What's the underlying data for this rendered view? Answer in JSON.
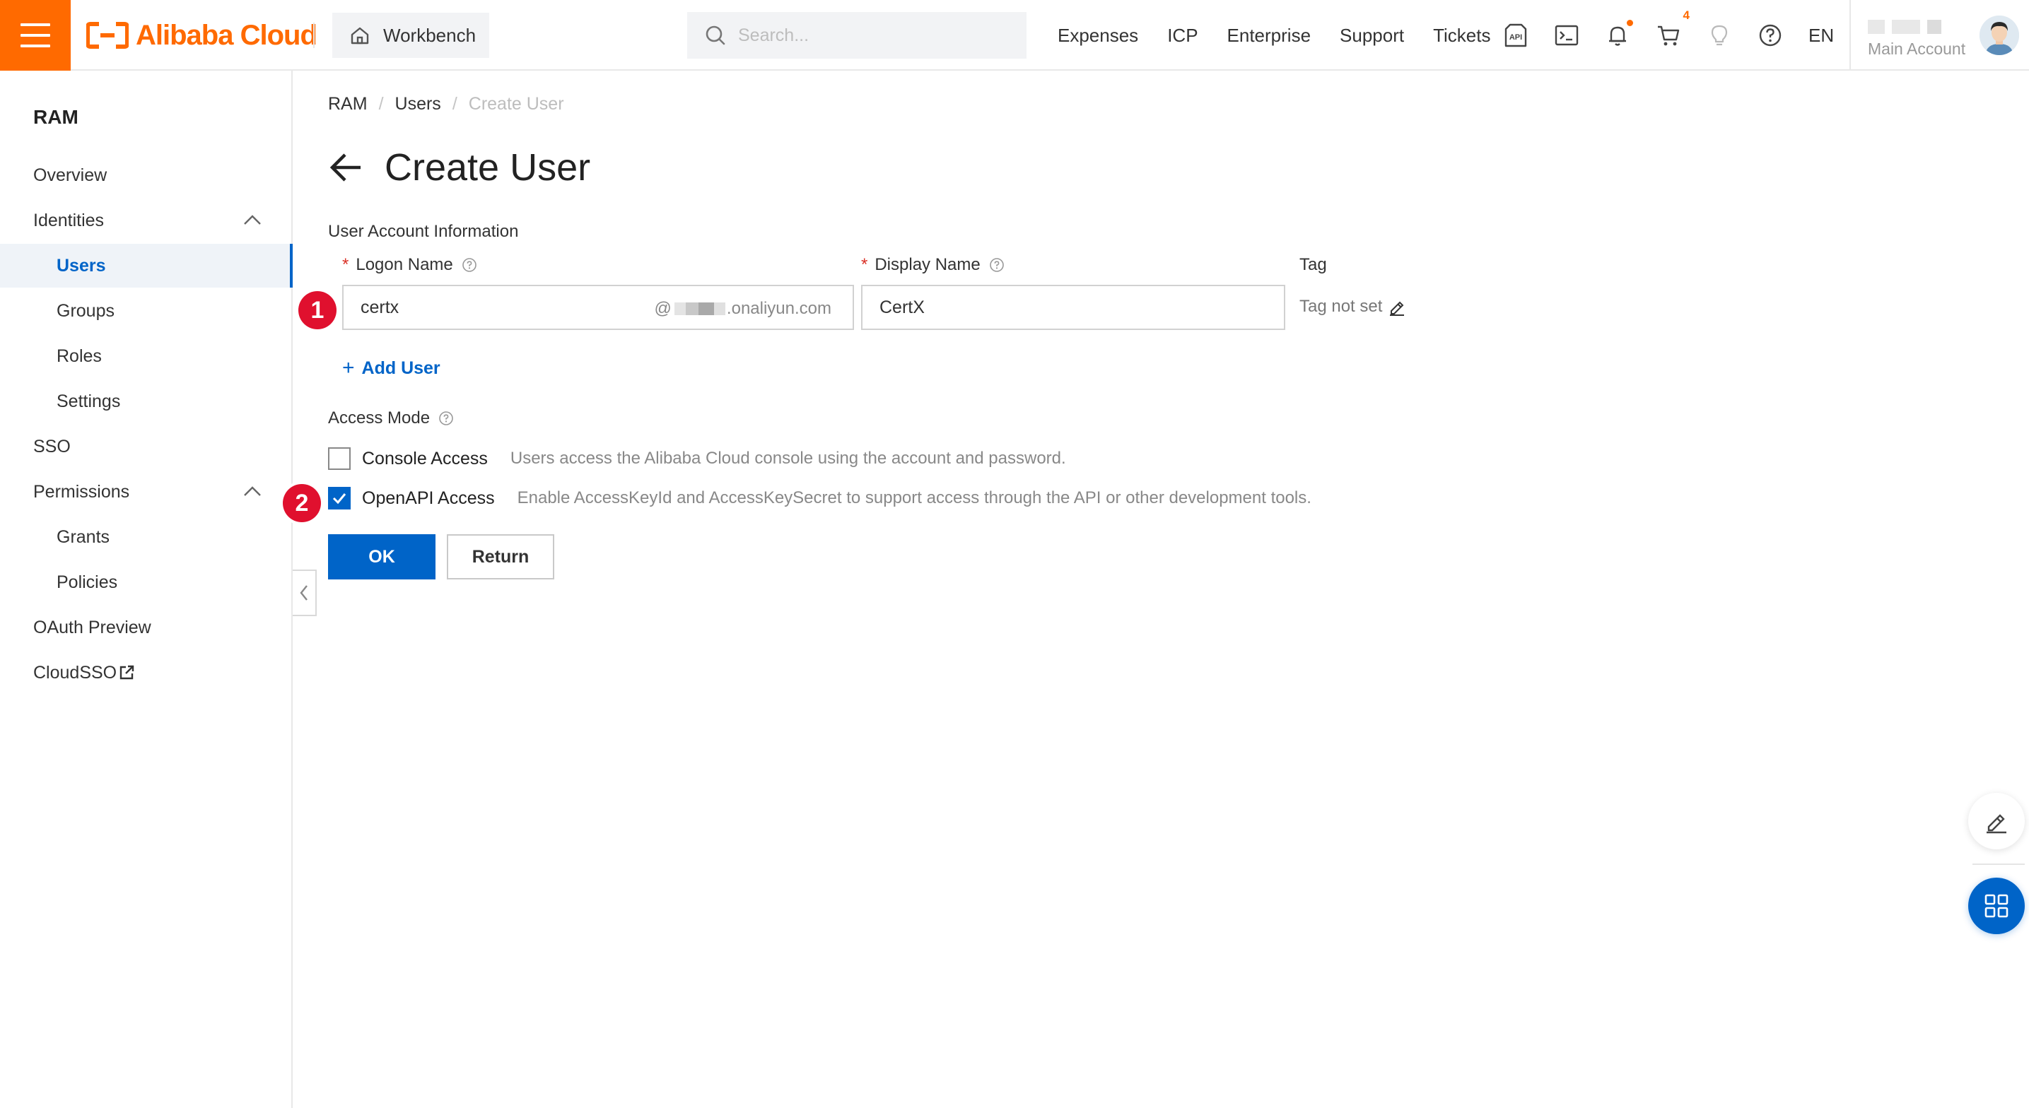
{
  "topbar": {
    "logo_text": "Alibaba Cloud",
    "workbench_label": "Workbench",
    "search_placeholder": "Search...",
    "nav": [
      "Expenses",
      "ICP",
      "Enterprise",
      "Support",
      "Tickets"
    ],
    "cart_count": "4",
    "language": "EN",
    "account_label": "Main Account",
    "brand_color": "#ff6a00"
  },
  "sidebar": {
    "title": "RAM",
    "items": [
      {
        "label": "Overview"
      },
      {
        "label": "Identities"
      },
      {
        "label": "Users"
      },
      {
        "label": "Groups"
      },
      {
        "label": "Roles"
      },
      {
        "label": "Settings"
      },
      {
        "label": "SSO"
      },
      {
        "label": "Permissions"
      },
      {
        "label": "Grants"
      },
      {
        "label": "Policies"
      },
      {
        "label": "OAuth Preview"
      },
      {
        "label": "CloudSSO"
      }
    ],
    "active_item": "Users"
  },
  "breadcrumb": [
    "RAM",
    "Users",
    "Create User"
  ],
  "page": {
    "title": "Create User",
    "section_label": "User Account Information",
    "logon_name_label": "Logon Name",
    "logon_name_value": "certx",
    "domain_at": "@",
    "domain_suffix": ".onaliyun.com",
    "display_name_label": "Display Name",
    "display_name_value": "CertX",
    "tag_label": "Tag",
    "tag_value": "Tag not set",
    "add_user": "Add User",
    "access_mode_label": "Access Mode",
    "console_access": {
      "label": "Console Access",
      "description": "Users access the Alibaba Cloud console using the account and password.",
      "checked": false
    },
    "openapi_access": {
      "label": "OpenAPI Access",
      "description": "Enable AccessKeyId and AccessKeySecret to support access through the API or other development tools.",
      "checked": true
    },
    "ok_button": "OK",
    "return_button": "Return"
  },
  "annotations": {
    "step1": "1",
    "step2": "2",
    "badge_color": "#e0102e"
  },
  "accent_color": "#0064c8"
}
